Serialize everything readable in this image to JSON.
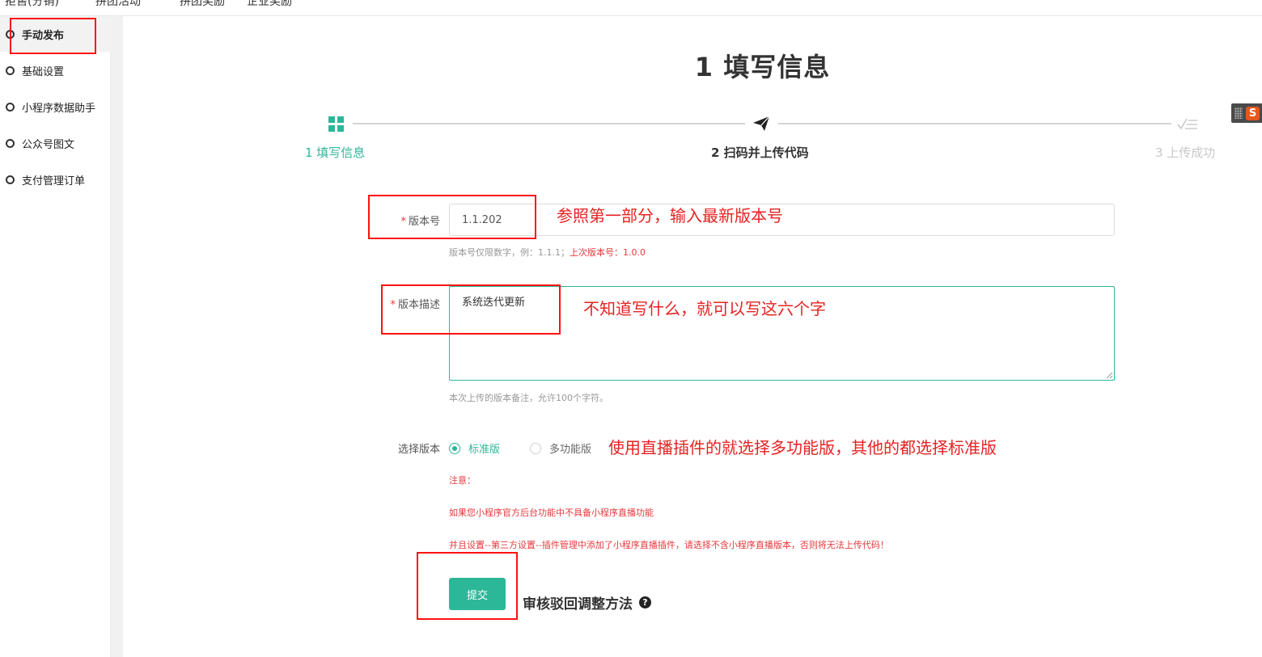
{
  "topnav": [
    {
      "label": "拒售(分销)"
    },
    {
      "label": "拼团活动"
    },
    {
      "label": "拼团奖励"
    },
    {
      "label": "企业奖励"
    }
  ],
  "sidebar": {
    "items": [
      {
        "label": "手动发布",
        "active": true
      },
      {
        "label": "基础设置"
      },
      {
        "label": "小程序数据助手"
      },
      {
        "label": "公众号图文"
      },
      {
        "label": "支付管理订单"
      }
    ]
  },
  "page": {
    "title": "1 填写信息"
  },
  "steps": [
    {
      "label": "1 填写信息",
      "state": "done",
      "icon": "grid-icon"
    },
    {
      "label": "2 扫码并上传代码",
      "state": "current",
      "icon": "paper-plane-icon"
    },
    {
      "label": "3 上传成功",
      "state": "pending",
      "icon": "checklist-icon"
    }
  ],
  "form": {
    "version": {
      "required_mark": "*",
      "label": "版本号",
      "value": "1.1.202",
      "hint_prefix": "版本号仅限数字，例：1.1.1；",
      "hint_last": "上次版本号：1.0.0"
    },
    "description": {
      "required_mark": "*",
      "label": "版本描述",
      "value": "系统迭代更新",
      "hint": "本次上传的版本备注，允许100个字符。"
    },
    "edition": {
      "label": "选择版本",
      "options": [
        {
          "label": "标准版",
          "checked": true
        },
        {
          "label": "多功能版",
          "checked": false
        }
      ]
    },
    "notes": [
      "注意：",
      "如果您小程序官方后台功能中不具备小程序直播功能",
      "并且设置--第三方设置--插件管理中添加了小程序直播插件，请选择不含小程序直播版本，否则将无法上传代码！"
    ],
    "submit_label": "提交",
    "help_link": "审核驳回调整方法",
    "help_icon": "?"
  },
  "annotations": {
    "version": "参照第一部分，输入最新版本号",
    "description": "不知道写什么，就可以写这六个字",
    "edition": "使用直播插件的就选择多功能版，其他的都选择标准版"
  },
  "colors": {
    "accent": "#2db799",
    "annotation_red": "#e62222",
    "warning_red": "#e4393c"
  },
  "floating_widget": {
    "icon": "sogou-ime-icon",
    "letter": "S"
  }
}
